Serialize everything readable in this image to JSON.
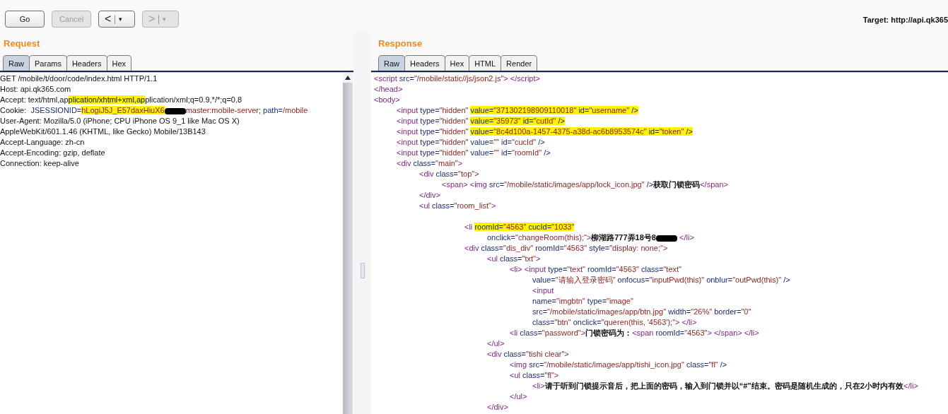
{
  "toolbar": {
    "buttons": [
      {
        "label": "Go",
        "disabled": false
      },
      {
        "label": "Cancel",
        "disabled": true
      }
    ],
    "history": [
      {
        "label": "<",
        "menu": "▾",
        "disabled": false
      },
      {
        "label": ">",
        "menu": "▾",
        "disabled": true
      }
    ],
    "target": "Target: http://api.qk365"
  },
  "request": {
    "title": "Request",
    "tabs": [
      {
        "label": "Raw",
        "selected": true
      },
      {
        "label": "Params",
        "selected": false
      },
      {
        "label": "Headers",
        "selected": false
      },
      {
        "label": "Hex",
        "selected": false
      }
    ],
    "lines": [
      {
        "segments": [
          {
            "kind": "plain",
            "text": "GET /mobile/t/door/code/index.html HTTP/1.1"
          }
        ]
      },
      {
        "segments": [
          {
            "kind": "plain",
            "text": "Host: api.qk365.com"
          }
        ]
      },
      {
        "segments": [
          {
            "kind": "plain",
            "text": "Accept: text/html,ap"
          },
          {
            "kind": "highlight",
            "segments": [
              {
                "kind": "plain",
                "text": "plication/xhtml+xml,ap"
              }
            ]
          },
          {
            "kind": "plain",
            "text": "plication/xml;q=0.9,*/*;q=0.8"
          }
        ]
      },
      {
        "segments": [
          {
            "kind": "plain",
            "text": "Cookie:  "
          },
          {
            "kind": "attr",
            "text": "JSESSIONID="
          },
          {
            "kind": "highlight",
            "segments": [
              {
                "kind": "value",
                "text": "hLogiJ5J_E57daxHiuX6"
              }
            ]
          },
          {
            "kind": "redaction"
          },
          {
            "kind": "value",
            "text": "master:mobile-server"
          },
          {
            "kind": "attr",
            "text": "; path="
          },
          {
            "kind": "value",
            "text": "/mobile"
          }
        ]
      },
      {
        "segments": [
          {
            "kind": "plain",
            "text": "User-Agent: Mozilla/5.0 (iPhone; CPU iPhone OS 9_1 like Mac OS X)"
          }
        ]
      },
      {
        "segments": [
          {
            "kind": "plain",
            "text": "AppleWebKit/601.1.46 (KHTML, like Gecko) Mobile/13B143"
          }
        ]
      },
      {
        "segments": [
          {
            "kind": "plain",
            "text": "Accept-Language: zh-cn"
          }
        ]
      },
      {
        "segments": [
          {
            "kind": "plain",
            "text": "Accept-Encoding: gzip, deflate"
          }
        ]
      },
      {
        "segments": [
          {
            "kind": "plain",
            "text": "Connection: keep-alive"
          }
        ]
      }
    ]
  },
  "response": {
    "title": "Response",
    "tabs": [
      {
        "label": "Raw",
        "selected": true
      },
      {
        "label": "Headers",
        "selected": false
      },
      {
        "label": "Hex",
        "selected": false
      },
      {
        "label": "HTML",
        "selected": false
      },
      {
        "label": "Render",
        "selected": false
      }
    ],
    "lines": [
      {
        "segments": [
          {
            "kind": "tag",
            "text": "<script"
          },
          {
            "kind": "attr",
            "text": " src="
          },
          {
            "kind": "value",
            "text": "\"/mobile/static//js/json2.js\""
          },
          {
            "kind": "tag",
            "text": "> </script>"
          }
        ]
      },
      {
        "segments": [
          {
            "kind": "tag",
            "text": "</head>"
          }
        ]
      },
      {
        "segments": [
          {
            "kind": "tag",
            "text": "<body>"
          }
        ]
      },
      {
        "segments": [
          {
            "kind": "tag",
            "text": "\t<input"
          },
          {
            "kind": "attr",
            "text": " type="
          },
          {
            "kind": "value",
            "text": "\"hidden\" "
          },
          {
            "kind": "highlight",
            "segments": [
              {
                "kind": "attr",
                "text": "value="
              },
              {
                "kind": "value",
                "text": "\"371302198909110018\""
              },
              {
                "kind": "attr",
                "text": " id="
              },
              {
                "kind": "value",
                "text": "\"username\""
              },
              {
                "kind": "attr",
                "text": " />"
              }
            ]
          }
        ]
      },
      {
        "segments": [
          {
            "kind": "tag",
            "text": "\t<input"
          },
          {
            "kind": "attr",
            "text": " type="
          },
          {
            "kind": "value",
            "text": "\"hidden\" "
          },
          {
            "kind": "highlight",
            "segments": [
              {
                "kind": "attr",
                "text": "value="
              },
              {
                "kind": "value",
                "text": "\"35973\""
              },
              {
                "kind": "attr",
                "text": " id="
              },
              {
                "kind": "value",
                "text": "\"cutId\""
              },
              {
                "kind": "attr",
                "text": " />"
              }
            ]
          }
        ]
      },
      {
        "segments": [
          {
            "kind": "tag",
            "text": "\t<input"
          },
          {
            "kind": "attr",
            "text": " type="
          },
          {
            "kind": "value",
            "text": "\"hidden\" "
          },
          {
            "kind": "highlight",
            "segments": [
              {
                "kind": "attr",
                "text": "value="
              },
              {
                "kind": "value",
                "text": "\"8c4d100a-1457-4375-a38d-ac6b8953574c\""
              },
              {
                "kind": "attr",
                "text": " id="
              },
              {
                "kind": "value",
                "text": "\"token\""
              },
              {
                "kind": "attr",
                "text": " />"
              }
            ]
          }
        ]
      },
      {
        "segments": [
          {
            "kind": "tag",
            "text": "\t<input"
          },
          {
            "kind": "attr",
            "text": " type="
          },
          {
            "kind": "value",
            "text": "\"hidden\""
          },
          {
            "kind": "attr",
            "text": " value="
          },
          {
            "kind": "value",
            "text": "\"\""
          },
          {
            "kind": "attr",
            "text": " id="
          },
          {
            "kind": "value",
            "text": "\"cucId\""
          },
          {
            "kind": "attr",
            "text": " />"
          }
        ]
      },
      {
        "segments": [
          {
            "kind": "tag",
            "text": "\t<input"
          },
          {
            "kind": "attr",
            "text": " type="
          },
          {
            "kind": "value",
            "text": "\"hidden\""
          },
          {
            "kind": "attr",
            "text": " value="
          },
          {
            "kind": "value",
            "text": "\"\""
          },
          {
            "kind": "attr",
            "text": " id="
          },
          {
            "kind": "value",
            "text": "\"roomId\""
          },
          {
            "kind": "attr",
            "text": " />"
          }
        ]
      },
      {
        "segments": [
          {
            "kind": "tag",
            "text": "\t<div"
          },
          {
            "kind": "attr",
            "text": " class="
          },
          {
            "kind": "value",
            "text": "\"main\""
          },
          {
            "kind": "tag",
            "text": ">"
          }
        ]
      },
      {
        "segments": [
          {
            "kind": "tag",
            "text": "\t\t<div"
          },
          {
            "kind": "attr",
            "text": " class="
          },
          {
            "kind": "value",
            "text": "\"top\""
          },
          {
            "kind": "tag",
            "text": ">"
          }
        ]
      },
      {
        "segments": [
          {
            "kind": "tag",
            "text": "\t\t\t<span> <img"
          },
          {
            "kind": "attr",
            "text": " src="
          },
          {
            "kind": "value",
            "text": "\"/mobile/static/images/app/lock_icon.jpg\""
          },
          {
            "kind": "attr",
            "text": " />"
          },
          {
            "kind": "text",
            "text": "获取门锁密码"
          },
          {
            "kind": "tag",
            "text": "</span>"
          }
        ]
      },
      {
        "segments": [
          {
            "kind": "tag",
            "text": "\t\t</div>"
          }
        ]
      },
      {
        "segments": [
          {
            "kind": "tag",
            "text": "\t\t<ul"
          },
          {
            "kind": "attr",
            "text": " class="
          },
          {
            "kind": "value",
            "text": "\"room_list\""
          },
          {
            "kind": "tag",
            "text": ">"
          }
        ]
      },
      {
        "kind": "blank"
      },
      {
        "segments": [
          {
            "kind": "tag",
            "text": "\t\t\t\t<li "
          },
          {
            "kind": "highlight",
            "segments": [
              {
                "kind": "attr",
                "text": "roomId="
              },
              {
                "kind": "value",
                "text": "\"4563\""
              },
              {
                "kind": "attr",
                "text": " cucId="
              },
              {
                "kind": "value",
                "text": "\"1033\""
              }
            ]
          }
        ]
      },
      {
        "segments": [
          {
            "kind": "attr",
            "text": "\t\t\t\t\tonclick="
          },
          {
            "kind": "value",
            "text": "\"changeRoom(this);\""
          },
          {
            "kind": "tag",
            "text": ">"
          },
          {
            "kind": "text",
            "text": "柳湖路777弄18号8"
          },
          {
            "kind": "redaction"
          },
          {
            "kind": "tag",
            "text": " </li>"
          }
        ]
      },
      {
        "segments": [
          {
            "kind": "tag",
            "text": "\t\t\t\t<div"
          },
          {
            "kind": "attr",
            "text": " class="
          },
          {
            "kind": "value",
            "text": "\"dis_div\""
          },
          {
            "kind": "attr",
            "text": " roomId="
          },
          {
            "kind": "value",
            "text": "\"4563\""
          },
          {
            "kind": "attr",
            "text": " style="
          },
          {
            "kind": "value",
            "text": "\"display: none;\""
          },
          {
            "kind": "tag",
            "text": ">"
          }
        ]
      },
      {
        "segments": [
          {
            "kind": "tag",
            "text": "\t\t\t\t\t<ul"
          },
          {
            "kind": "attr",
            "text": " class="
          },
          {
            "kind": "value",
            "text": "\"txt\""
          },
          {
            "kind": "tag",
            "text": ">"
          }
        ]
      },
      {
        "segments": [
          {
            "kind": "tag",
            "text": "\t\t\t\t\t\t<li> <input"
          },
          {
            "kind": "attr",
            "text": " type="
          },
          {
            "kind": "value",
            "text": "\"text\""
          },
          {
            "kind": "attr",
            "text": " roomId="
          },
          {
            "kind": "value",
            "text": "\"4563\""
          },
          {
            "kind": "attr",
            "text": " class="
          },
          {
            "kind": "value",
            "text": "\"text\""
          }
        ]
      },
      {
        "segments": [
          {
            "kind": "attr",
            "text": "\t\t\t\t\t\t\tvalue="
          },
          {
            "kind": "value",
            "text": "\"请输入登录密码\""
          },
          {
            "kind": "attr",
            "text": " onfocus="
          },
          {
            "kind": "value",
            "text": "\"inputPwd(this)\""
          },
          {
            "kind": "attr",
            "text": " onblur="
          },
          {
            "kind": "value",
            "text": "\"outPwd(this)\""
          },
          {
            "kind": "attr",
            "text": " />"
          }
        ]
      },
      {
        "segments": [
          {
            "kind": "tag",
            "text": "\t\t\t\t\t\t\t<input"
          }
        ]
      },
      {
        "segments": [
          {
            "kind": "attr",
            "text": "\t\t\t\t\t\t\tname="
          },
          {
            "kind": "value",
            "text": "\"imgbtn\""
          },
          {
            "kind": "attr",
            "text": " type="
          },
          {
            "kind": "value",
            "text": "\"image\""
          }
        ]
      },
      {
        "segments": [
          {
            "kind": "attr",
            "text": "\t\t\t\t\t\t\tsrc="
          },
          {
            "kind": "value",
            "text": "\"/mobile/static/images/app/btn.jpg\""
          },
          {
            "kind": "attr",
            "text": " width="
          },
          {
            "kind": "value",
            "text": "\"26%\""
          },
          {
            "kind": "attr",
            "text": " border="
          },
          {
            "kind": "value",
            "text": "\"0\""
          }
        ]
      },
      {
        "segments": [
          {
            "kind": "attr",
            "text": "\t\t\t\t\t\t\tclass="
          },
          {
            "kind": "value",
            "text": "\"btn\""
          },
          {
            "kind": "attr",
            "text": " onclick="
          },
          {
            "kind": "value",
            "text": "\"queren(this, '4563');\""
          },
          {
            "kind": "tag",
            "text": "> </li>"
          }
        ]
      },
      {
        "segments": [
          {
            "kind": "tag",
            "text": "\t\t\t\t\t\t<li"
          },
          {
            "kind": "attr",
            "text": " class="
          },
          {
            "kind": "value",
            "text": "\"password\""
          },
          {
            "kind": "tag",
            "text": ">"
          },
          {
            "kind": "text",
            "text": "门锁密码为："
          },
          {
            "kind": "tag",
            "text": "<span"
          },
          {
            "kind": "attr",
            "text": " roomId="
          },
          {
            "kind": "value",
            "text": "\"4563\""
          },
          {
            "kind": "tag",
            "text": "> </span> </li>"
          }
        ]
      },
      {
        "segments": [
          {
            "kind": "tag",
            "text": "\t\t\t\t\t</ul>"
          }
        ]
      },
      {
        "segments": [
          {
            "kind": "tag",
            "text": "\t\t\t\t\t<div"
          },
          {
            "kind": "attr",
            "text": " class="
          },
          {
            "kind": "value",
            "text": "\"tishi clear\""
          },
          {
            "kind": "tag",
            "text": ">"
          }
        ]
      },
      {
        "segments": [
          {
            "kind": "tag",
            "text": "\t\t\t\t\t\t<img"
          },
          {
            "kind": "attr",
            "text": " src="
          },
          {
            "kind": "value",
            "text": "\"/mobile/static/images/app/tishi_icon.jpg\""
          },
          {
            "kind": "attr",
            "text": " class="
          },
          {
            "kind": "value",
            "text": "\"fl\""
          },
          {
            "kind": "attr",
            "text": " />"
          }
        ]
      },
      {
        "segments": [
          {
            "kind": "tag",
            "text": "\t\t\t\t\t\t<ul"
          },
          {
            "kind": "attr",
            "text": " class="
          },
          {
            "kind": "value",
            "text": "\"fl\""
          },
          {
            "kind": "tag",
            "text": ">"
          }
        ]
      },
      {
        "segments": [
          {
            "kind": "tag",
            "text": "\t\t\t\t\t\t\t<li>"
          },
          {
            "kind": "text",
            "text": "请于听到门锁提示音后，把上面的密码，输入到门锁并以“#”结束。密码是随机生成的，只在2小时内有效"
          },
          {
            "kind": "tag",
            "text": "</li>"
          }
        ]
      },
      {
        "segments": [
          {
            "kind": "tag",
            "text": "\t\t\t\t\t\t</ul>"
          }
        ]
      },
      {
        "segments": [
          {
            "kind": "tag",
            "text": "\t\t\t\t\t</div>"
          }
        ]
      }
    ]
  }
}
